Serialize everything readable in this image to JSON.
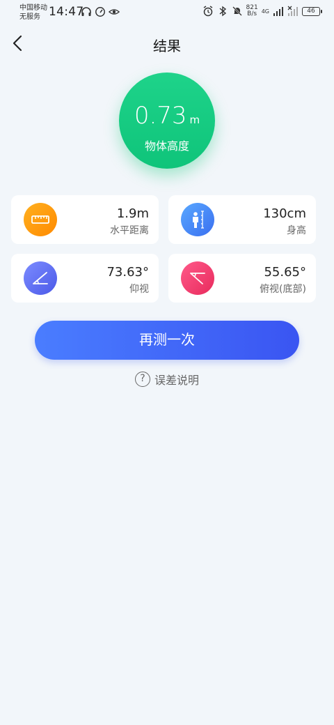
{
  "status_bar": {
    "carrier_line1": "中国移动",
    "carrier_line2": "无服务",
    "time": "14:47",
    "net_speed_top": "821",
    "net_speed_bottom": "B/s",
    "signal_label": "4G",
    "battery": "46"
  },
  "header": {
    "title": "结果"
  },
  "result": {
    "value": "0.73",
    "unit": "m",
    "label": "物体高度"
  },
  "cards": [
    {
      "value": "1.9m",
      "label": "水平距离",
      "icon": "ruler-icon"
    },
    {
      "value": "130cm",
      "label": "身高",
      "icon": "person-height-icon"
    },
    {
      "value": "73.63°",
      "label": "仰视",
      "icon": "angle-up-icon"
    },
    {
      "value": "55.65°",
      "label": "俯视(底部)",
      "icon": "angle-down-icon"
    }
  ],
  "actions": {
    "retry_label": "再测一次",
    "help_label": "误差说明",
    "help_icon_glyph": "?"
  }
}
